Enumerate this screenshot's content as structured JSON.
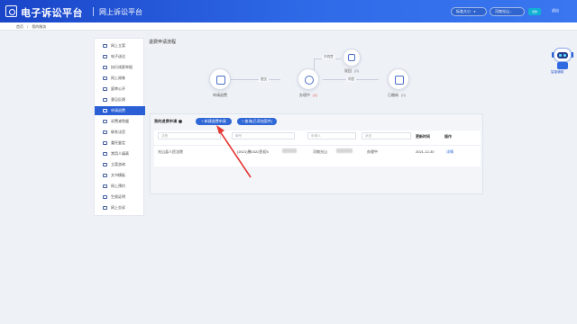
{
  "header": {
    "brand": "电子诉讼平台",
    "subbrand": "网上诉讼平台",
    "font_size_label": "标准大小",
    "court_select": "河南光山...",
    "switch_btn": "切换",
    "logout": "退出",
    "chevron_icon": "chevron-down-icon"
  },
  "breadcrumb": [
    "首页",
    "我的服务"
  ],
  "sidebar": {
    "items": [
      {
        "label": "网上立案",
        "icon": "file-upload-icon",
        "active": false
      },
      {
        "label": "电子送达",
        "icon": "send-icon",
        "active": false
      },
      {
        "label": "执行线索举报",
        "icon": "report-user-icon",
        "active": false
      },
      {
        "label": "网上阅卷",
        "icon": "folder-icon",
        "active": false
      },
      {
        "label": "庭审公开",
        "icon": "monitor-icon",
        "active": false
      },
      {
        "label": "意见反馈",
        "icon": "chat-icon",
        "active": false
      },
      {
        "label": "申请退费",
        "icon": "refund-icon",
        "active": true
      },
      {
        "label": "诉费减免缓",
        "icon": "money-icon",
        "active": false
      },
      {
        "label": "联系法官",
        "icon": "contact-icon",
        "active": false
      },
      {
        "label": "委托鉴定",
        "icon": "seal-icon",
        "active": false
      },
      {
        "label": "常用人填表",
        "icon": "user-form-icon",
        "active": false
      },
      {
        "label": "立案咨询",
        "icon": "question-icon",
        "active": false
      },
      {
        "label": "文书模板",
        "icon": "template-icon",
        "active": false
      },
      {
        "label": "网上预约",
        "icon": "calendar-icon",
        "active": false
      },
      {
        "label": "生效证明",
        "icon": "certificate-icon",
        "active": false
      },
      {
        "label": "网上交诉",
        "icon": "upload-icon",
        "active": false
      }
    ]
  },
  "main": {
    "title": "退费申请流程",
    "flow": {
      "steps": [
        {
          "label": "申请退费",
          "count": "",
          "icon": "edit-document-icon"
        },
        {
          "label": "办理中",
          "count": "(1)",
          "icon": "cloud-process-icon"
        },
        {
          "label": "驳回",
          "count": "(0)",
          "icon": "reject-icon"
        },
        {
          "label": "已缴纳",
          "count": "(0)",
          "icon": "complete-icon"
        }
      ],
      "edges": {
        "submit": "提交",
        "not_approved": "不同意",
        "approved": "同意"
      }
    },
    "list": {
      "title": "我的退费申请",
      "help_icon": "help-circle-icon",
      "add_button": "+ 新建退费申请",
      "query_button": "+ 查询(已添加案件)",
      "filters": [
        "法院",
        "案号",
        "申请人",
        "状态"
      ],
      "columns": [
        "更新时间",
        "操作"
      ],
      "rows": [
        {
          "court": "光山县人民法院",
          "case_no": "(2021)豫1522民初5",
          "applicant": "河南光山",
          "status": "办理中",
          "updated": "2021-12-30",
          "action": "详情"
        }
      ]
    }
  },
  "assistant": {
    "label": "智能辅助",
    "icon": "robot-icon"
  },
  "colors": {
    "header_start": "#1a45c9",
    "header_end": "#3a76ef",
    "primary": "#2a5fd6",
    "annotation": "#e53935",
    "count_red": "#e34848"
  }
}
